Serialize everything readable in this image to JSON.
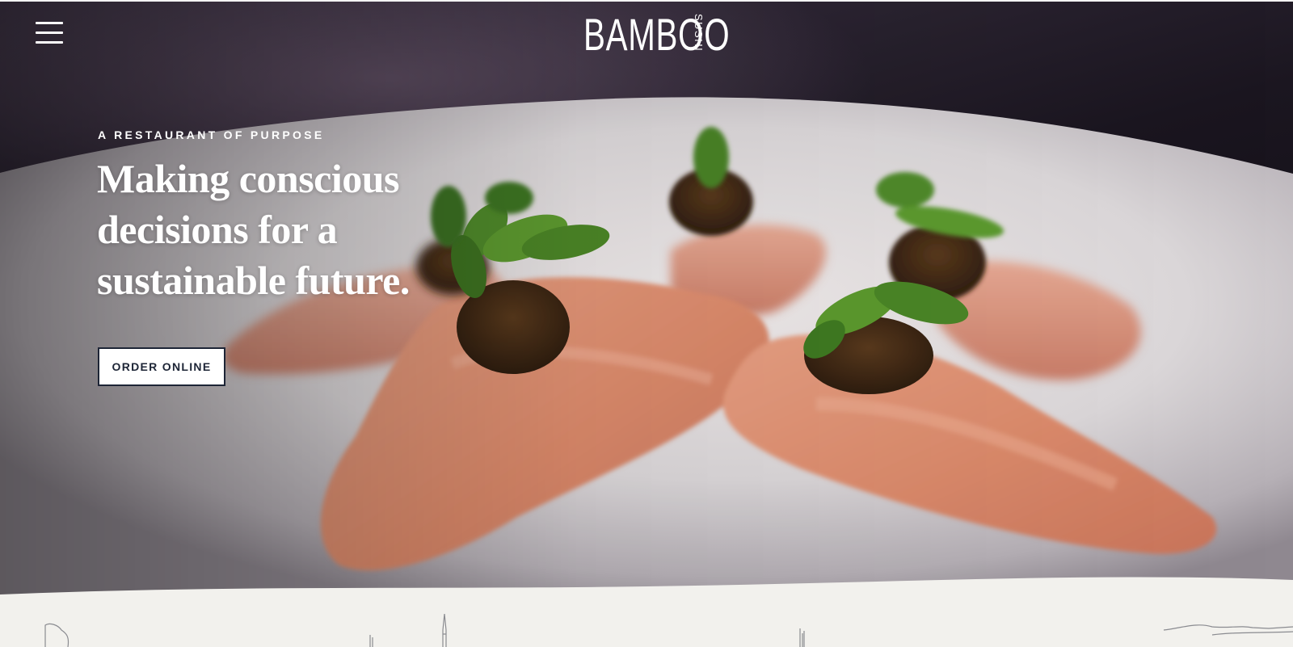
{
  "header": {
    "menu_icon": "hamburger-menu-icon",
    "logo": {
      "main": "BAMBOO",
      "sub": "SUSHI"
    }
  },
  "hero": {
    "image": "sashimi-plate-photo",
    "eyebrow": "A RESTAURANT OF PURPOSE",
    "headline": "Making conscious decisions for a sustainable future.",
    "cta_label": "ORDER ONLINE"
  },
  "decoration": {
    "skyline": "city-skyline-line-illustration"
  },
  "colors": {
    "text_on_hero": "#ffffff",
    "button_bg": "#ffffff",
    "button_text": "#1d2536",
    "section_bg": "#f2f1ed",
    "skyline_stroke": "#8a8b90"
  }
}
